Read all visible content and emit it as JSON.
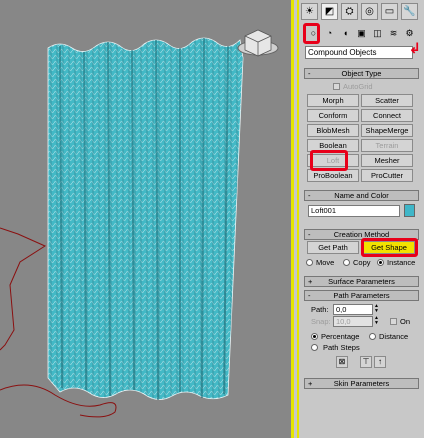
{
  "command_panel": {
    "tabs": [
      {
        "icon": "sun-icon",
        "glyph": "☀"
      },
      {
        "icon": "modify-icon",
        "glyph": "◩"
      },
      {
        "icon": "hierarchy-icon",
        "glyph": "⛭"
      },
      {
        "icon": "motion-icon",
        "glyph": "◎"
      },
      {
        "icon": "display-icon",
        "glyph": "▭"
      },
      {
        "icon": "utilities-icon",
        "glyph": "🔧"
      }
    ],
    "subtabs": [
      {
        "icon": "geometry-icon",
        "glyph": "○"
      },
      {
        "icon": "shapes-icon",
        "glyph": "◔"
      },
      {
        "icon": "lights-icon",
        "glyph": "◖"
      },
      {
        "icon": "cameras-icon",
        "glyph": "▣"
      },
      {
        "icon": "helpers-icon",
        "glyph": "◫"
      },
      {
        "icon": "spacewarps-icon",
        "glyph": "≋"
      },
      {
        "icon": "systems-icon",
        "glyph": "⚙"
      }
    ],
    "category_dropdown": "Compound Objects",
    "object_type": {
      "title": "Object Type",
      "autogrid_label": "AutoGrid",
      "buttons": [
        "Morph",
        "Scatter",
        "Conform",
        "Connect",
        "BlobMesh",
        "ShapeMerge",
        "Boolean",
        "Terrain",
        "Loft",
        "Mesher",
        "ProBoolean",
        "ProCutter"
      ]
    },
    "name_and_color": {
      "title": "Name and Color",
      "name_value": "Loft001",
      "color": "#3fb6c8"
    },
    "creation_method": {
      "title": "Creation Method",
      "get_path": "Get Path",
      "get_shape": "Get Shape",
      "move": "Move",
      "copy": "Copy",
      "instance": "Instance"
    },
    "surface_parameters": {
      "title": "Surface Parameters"
    },
    "path_parameters": {
      "title": "Path Parameters",
      "path_label": "Path:",
      "path_value": "0,0",
      "snap_label": "Snap:",
      "snap_value": "10,0",
      "on_label": "On",
      "percentage": "Percentage",
      "distance": "Distance",
      "path_steps": "Path Steps"
    },
    "skin_parameters": {
      "title": "Skin Parameters"
    },
    "signs": {
      "open": "-",
      "closed": "+"
    }
  },
  "viewport": {
    "background": "#878787",
    "mesh_color": "#3fb6c8",
    "active_border": "#e6e600"
  },
  "annotation_color": "#e8001a"
}
